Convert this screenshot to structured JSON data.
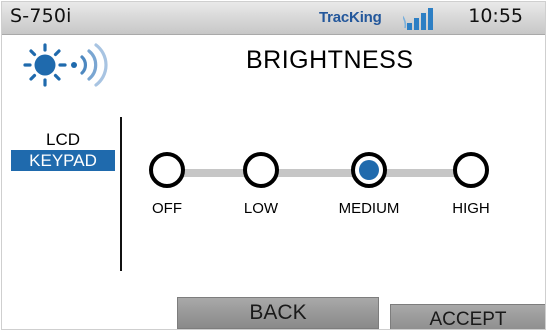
{
  "status_bar": {
    "device_model": "S-750i",
    "brand": "TracKing",
    "time": "10:55"
  },
  "header": {
    "title": "BRIGHTNESS",
    "icon": "brightness-icon"
  },
  "side_menu": {
    "items": [
      {
        "label": "LCD",
        "selected": false
      },
      {
        "label": "KEYPAD",
        "selected": true
      }
    ]
  },
  "brightness_slider": {
    "selected": "MEDIUM",
    "options": [
      {
        "label": "OFF"
      },
      {
        "label": "LOW"
      },
      {
        "label": "MEDIUM"
      },
      {
        "label": "HIGH"
      }
    ]
  },
  "buttons": {
    "back_label": "BACK",
    "accept_label": "ACCEPT"
  },
  "colors": {
    "accent": "#1f6aad",
    "brand": "#23579b",
    "track": "#c6c6c6",
    "button": "#9a9a9a"
  }
}
